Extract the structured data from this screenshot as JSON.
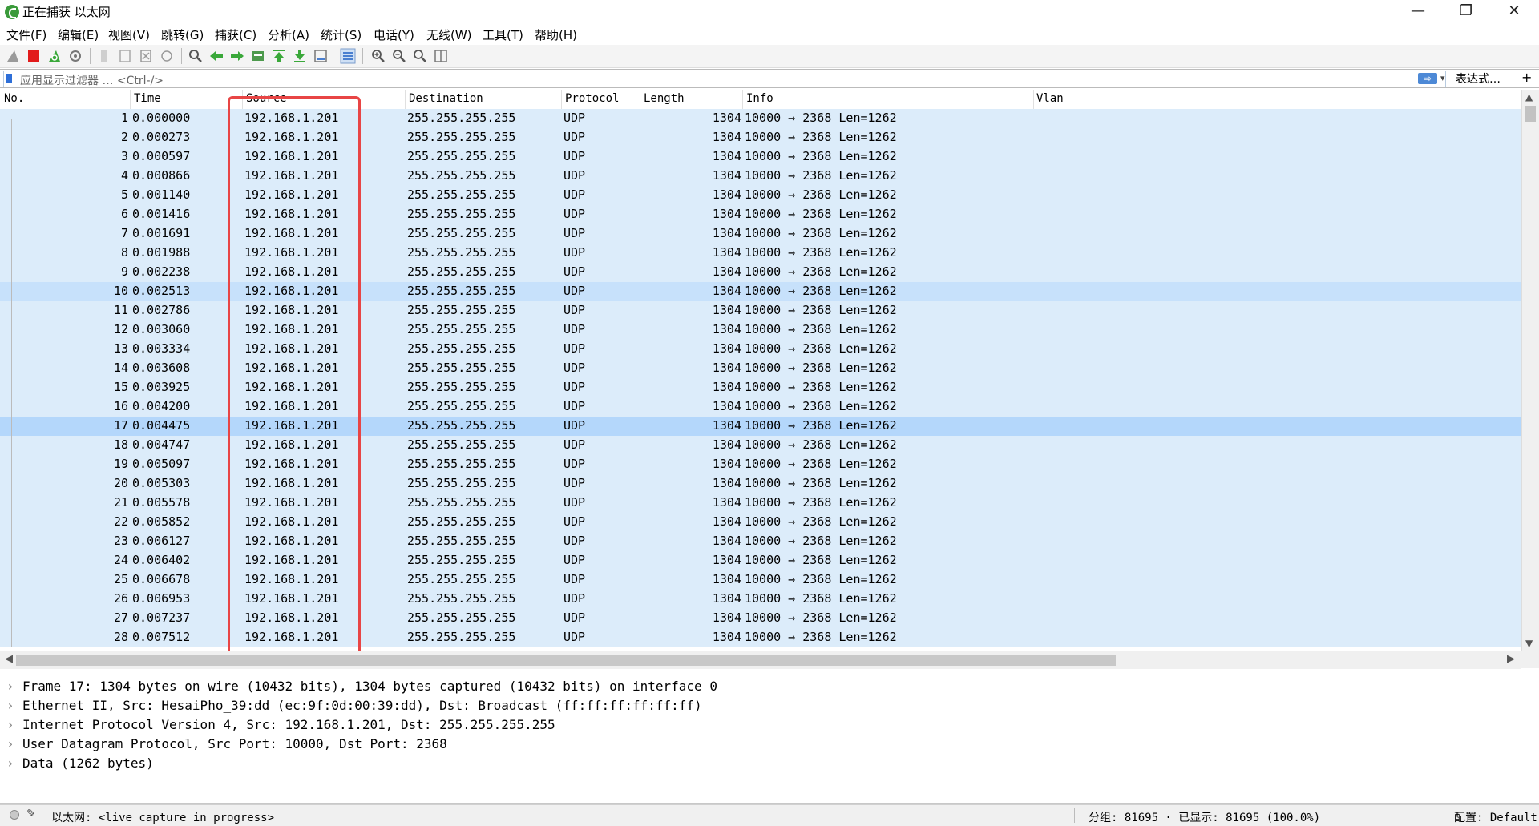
{
  "window": {
    "title": "正在捕获 以太网",
    "minimize": "—",
    "restore": "❐",
    "close": "✕"
  },
  "menu": [
    "文件(F)",
    "编辑(E)",
    "视图(V)",
    "跳转(G)",
    "捕获(C)",
    "分析(A)",
    "统计(S)",
    "电话(Y)",
    "无线(W)",
    "工具(T)",
    "帮助(H)"
  ],
  "toolbar": {
    "icons": [
      "shark-fin-start-icon",
      "stop-capture-icon",
      "restart-capture-icon",
      "capture-options-icon",
      "open-file-icon",
      "save-file-icon",
      "close-file-icon",
      "reload-file-icon",
      "find-packet-icon",
      "go-back-icon",
      "go-forward-icon",
      "go-to-packet-icon",
      "first-packet-icon",
      "last-packet-icon",
      "auto-scroll-icon",
      "colorize-icon",
      "zoom-in-icon",
      "zoom-out-icon",
      "zoom-normal-icon",
      "resize-columns-icon"
    ]
  },
  "filter": {
    "placeholder": "应用显示过滤器 … <Ctrl-/>",
    "apply": "⇨",
    "dropdown": "▾",
    "expression": "表达式…",
    "add": "+"
  },
  "columns": {
    "no": "No.",
    "time": "Time",
    "source": "Source",
    "destination": "Destination",
    "protocol": "Protocol",
    "length": "Length",
    "info": "Info",
    "vlan": "Vlan"
  },
  "packets": [
    {
      "no": "1",
      "time": "0.000000",
      "src": "192.168.1.201",
      "dst": "255.255.255.255",
      "proto": "UDP",
      "len": "1304",
      "info": "10000 → 2368 Len=1262"
    },
    {
      "no": "2",
      "time": "0.000273",
      "src": "192.168.1.201",
      "dst": "255.255.255.255",
      "proto": "UDP",
      "len": "1304",
      "info": "10000 → 2368 Len=1262"
    },
    {
      "no": "3",
      "time": "0.000597",
      "src": "192.168.1.201",
      "dst": "255.255.255.255",
      "proto": "UDP",
      "len": "1304",
      "info": "10000 → 2368 Len=1262"
    },
    {
      "no": "4",
      "time": "0.000866",
      "src": "192.168.1.201",
      "dst": "255.255.255.255",
      "proto": "UDP",
      "len": "1304",
      "info": "10000 → 2368 Len=1262"
    },
    {
      "no": "5",
      "time": "0.001140",
      "src": "192.168.1.201",
      "dst": "255.255.255.255",
      "proto": "UDP",
      "len": "1304",
      "info": "10000 → 2368 Len=1262"
    },
    {
      "no": "6",
      "time": "0.001416",
      "src": "192.168.1.201",
      "dst": "255.255.255.255",
      "proto": "UDP",
      "len": "1304",
      "info": "10000 → 2368 Len=1262"
    },
    {
      "no": "7",
      "time": "0.001691",
      "src": "192.168.1.201",
      "dst": "255.255.255.255",
      "proto": "UDP",
      "len": "1304",
      "info": "10000 → 2368 Len=1262"
    },
    {
      "no": "8",
      "time": "0.001988",
      "src": "192.168.1.201",
      "dst": "255.255.255.255",
      "proto": "UDP",
      "len": "1304",
      "info": "10000 → 2368 Len=1262"
    },
    {
      "no": "9",
      "time": "0.002238",
      "src": "192.168.1.201",
      "dst": "255.255.255.255",
      "proto": "UDP",
      "len": "1304",
      "info": "10000 → 2368 Len=1262"
    },
    {
      "no": "10",
      "time": "0.002513",
      "src": "192.168.1.201",
      "dst": "255.255.255.255",
      "proto": "UDP",
      "len": "1304",
      "info": "10000 → 2368 Len=1262"
    },
    {
      "no": "11",
      "time": "0.002786",
      "src": "192.168.1.201",
      "dst": "255.255.255.255",
      "proto": "UDP",
      "len": "1304",
      "info": "10000 → 2368 Len=1262"
    },
    {
      "no": "12",
      "time": "0.003060",
      "src": "192.168.1.201",
      "dst": "255.255.255.255",
      "proto": "UDP",
      "len": "1304",
      "info": "10000 → 2368 Len=1262"
    },
    {
      "no": "13",
      "time": "0.003334",
      "src": "192.168.1.201",
      "dst": "255.255.255.255",
      "proto": "UDP",
      "len": "1304",
      "info": "10000 → 2368 Len=1262"
    },
    {
      "no": "14",
      "time": "0.003608",
      "src": "192.168.1.201",
      "dst": "255.255.255.255",
      "proto": "UDP",
      "len": "1304",
      "info": "10000 → 2368 Len=1262"
    },
    {
      "no": "15",
      "time": "0.003925",
      "src": "192.168.1.201",
      "dst": "255.255.255.255",
      "proto": "UDP",
      "len": "1304",
      "info": "10000 → 2368 Len=1262"
    },
    {
      "no": "16",
      "time": "0.004200",
      "src": "192.168.1.201",
      "dst": "255.255.255.255",
      "proto": "UDP",
      "len": "1304",
      "info": "10000 → 2368 Len=1262"
    },
    {
      "no": "17",
      "time": "0.004475",
      "src": "192.168.1.201",
      "dst": "255.255.255.255",
      "proto": "UDP",
      "len": "1304",
      "info": "10000 → 2368 Len=1262"
    },
    {
      "no": "18",
      "time": "0.004747",
      "src": "192.168.1.201",
      "dst": "255.255.255.255",
      "proto": "UDP",
      "len": "1304",
      "info": "10000 → 2368 Len=1262"
    },
    {
      "no": "19",
      "time": "0.005097",
      "src": "192.168.1.201",
      "dst": "255.255.255.255",
      "proto": "UDP",
      "len": "1304",
      "info": "10000 → 2368 Len=1262"
    },
    {
      "no": "20",
      "time": "0.005303",
      "src": "192.168.1.201",
      "dst": "255.255.255.255",
      "proto": "UDP",
      "len": "1304",
      "info": "10000 → 2368 Len=1262"
    },
    {
      "no": "21",
      "time": "0.005578",
      "src": "192.168.1.201",
      "dst": "255.255.255.255",
      "proto": "UDP",
      "len": "1304",
      "info": "10000 → 2368 Len=1262"
    },
    {
      "no": "22",
      "time": "0.005852",
      "src": "192.168.1.201",
      "dst": "255.255.255.255",
      "proto": "UDP",
      "len": "1304",
      "info": "10000 → 2368 Len=1262"
    },
    {
      "no": "23",
      "time": "0.006127",
      "src": "192.168.1.201",
      "dst": "255.255.255.255",
      "proto": "UDP",
      "len": "1304",
      "info": "10000 → 2368 Len=1262"
    },
    {
      "no": "24",
      "time": "0.006402",
      "src": "192.168.1.201",
      "dst": "255.255.255.255",
      "proto": "UDP",
      "len": "1304",
      "info": "10000 → 2368 Len=1262"
    },
    {
      "no": "25",
      "time": "0.006678",
      "src": "192.168.1.201",
      "dst": "255.255.255.255",
      "proto": "UDP",
      "len": "1304",
      "info": "10000 → 2368 Len=1262"
    },
    {
      "no": "26",
      "time": "0.006953",
      "src": "192.168.1.201",
      "dst": "255.255.255.255",
      "proto": "UDP",
      "len": "1304",
      "info": "10000 → 2368 Len=1262"
    },
    {
      "no": "27",
      "time": "0.007237",
      "src": "192.168.1.201",
      "dst": "255.255.255.255",
      "proto": "UDP",
      "len": "1304",
      "info": "10000 → 2368 Len=1262"
    },
    {
      "no": "28",
      "time": "0.007512",
      "src": "192.168.1.201",
      "dst": "255.255.255.255",
      "proto": "UDP",
      "len": "1304",
      "info": "10000 → 2368 Len=1262"
    }
  ],
  "selected_packet": "17",
  "marked_packet": "10",
  "details": [
    "Frame 17: 1304 bytes on wire (10432 bits), 1304 bytes captured (10432 bits) on interface 0",
    "Ethernet II, Src: HesaiPho_39:dd (ec:9f:0d:00:39:dd), Dst: Broadcast (ff:ff:ff:ff:ff:ff)",
    "Internet Protocol Version 4, Src: 192.168.1.201, Dst: 255.255.255.255",
    "User Datagram Protocol, Src Port: 10000, Dst Port: 2368",
    "Data (1262 bytes)"
  ],
  "status": {
    "interface": "以太网: <live capture in progress>",
    "packets": "分组: 81695 · 已显示: 81695 (100.0%)",
    "profile": "配置: Default"
  },
  "colors": {
    "row": "#dcecfa",
    "marked_row": "#c7e1fb",
    "selected_row": "#b4d7fb",
    "highlight_box": "#e84545"
  }
}
